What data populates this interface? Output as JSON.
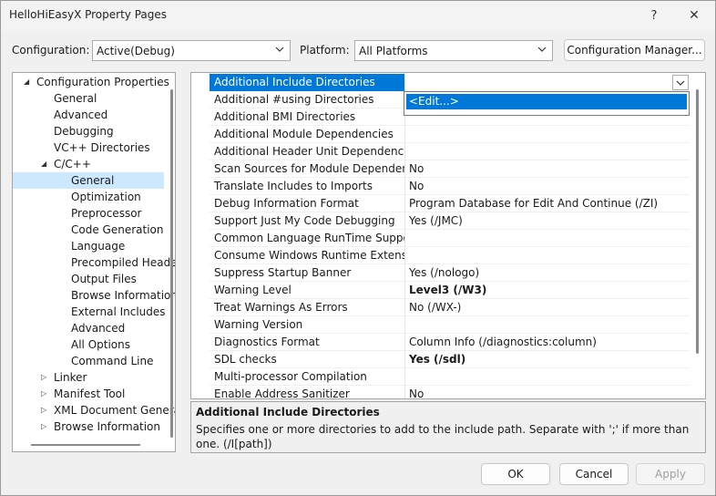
{
  "window": {
    "title": "HelloHiEasyX Property Pages",
    "help_glyph": "?",
    "close_glyph": "✕"
  },
  "top": {
    "configuration_label": "Configuration:",
    "configuration_value": "Active(Debug)",
    "platform_label": "Platform:",
    "platform_value": "All Platforms",
    "config_manager_button": "Configuration Manager..."
  },
  "tree": [
    {
      "label": "Configuration Properties",
      "indent": 0,
      "arrow": "expanded",
      "selected": false
    },
    {
      "label": "General",
      "indent": 1,
      "arrow": "",
      "selected": false
    },
    {
      "label": "Advanced",
      "indent": 1,
      "arrow": "",
      "selected": false
    },
    {
      "label": "Debugging",
      "indent": 1,
      "arrow": "",
      "selected": false
    },
    {
      "label": "VC++ Directories",
      "indent": 1,
      "arrow": "",
      "selected": false
    },
    {
      "label": "C/C++",
      "indent": 1,
      "arrow": "expanded",
      "selected": false
    },
    {
      "label": "General",
      "indent": 2,
      "arrow": "",
      "selected": true
    },
    {
      "label": "Optimization",
      "indent": 2,
      "arrow": "",
      "selected": false
    },
    {
      "label": "Preprocessor",
      "indent": 2,
      "arrow": "",
      "selected": false
    },
    {
      "label": "Code Generation",
      "indent": 2,
      "arrow": "",
      "selected": false
    },
    {
      "label": "Language",
      "indent": 2,
      "arrow": "",
      "selected": false
    },
    {
      "label": "Precompiled Heade",
      "indent": 2,
      "arrow": "",
      "selected": false
    },
    {
      "label": "Output Files",
      "indent": 2,
      "arrow": "",
      "selected": false
    },
    {
      "label": "Browse Information",
      "indent": 2,
      "arrow": "",
      "selected": false
    },
    {
      "label": "External Includes",
      "indent": 2,
      "arrow": "",
      "selected": false
    },
    {
      "label": "Advanced",
      "indent": 2,
      "arrow": "",
      "selected": false
    },
    {
      "label": "All Options",
      "indent": 2,
      "arrow": "",
      "selected": false
    },
    {
      "label": "Command Line",
      "indent": 2,
      "arrow": "",
      "selected": false
    },
    {
      "label": "Linker",
      "indent": 1,
      "arrow": "collapsed",
      "selected": false
    },
    {
      "label": "Manifest Tool",
      "indent": 1,
      "arrow": "collapsed",
      "selected": false
    },
    {
      "label": "XML Document Genera",
      "indent": 1,
      "arrow": "collapsed",
      "selected": false
    },
    {
      "label": "Browse Information",
      "indent": 1,
      "arrow": "collapsed",
      "selected": false
    }
  ],
  "properties": [
    {
      "name": "Additional Include Directories",
      "value": "",
      "bold": false,
      "selected": true
    },
    {
      "name": "Additional #using Directories",
      "value": "",
      "bold": false,
      "selected": false
    },
    {
      "name": "Additional BMI Directories",
      "value": "",
      "bold": false,
      "selected": false
    },
    {
      "name": "Additional Module Dependencies",
      "value": "",
      "bold": false,
      "selected": false
    },
    {
      "name": "Additional Header Unit Dependencies",
      "value": "",
      "bold": false,
      "selected": false
    },
    {
      "name": "Scan Sources for Module Dependencies",
      "value": "No",
      "bold": false,
      "selected": false
    },
    {
      "name": "Translate Includes to Imports",
      "value": "No",
      "bold": false,
      "selected": false
    },
    {
      "name": "Debug Information Format",
      "value": "Program Database for Edit And Continue (/ZI)",
      "bold": false,
      "selected": false
    },
    {
      "name": "Support Just My Code Debugging",
      "value": "Yes (/JMC)",
      "bold": false,
      "selected": false
    },
    {
      "name": "Common Language RunTime Support",
      "value": "",
      "bold": false,
      "selected": false
    },
    {
      "name": "Consume Windows Runtime Extension",
      "value": "",
      "bold": false,
      "selected": false
    },
    {
      "name": "Suppress Startup Banner",
      "value": "Yes (/nologo)",
      "bold": false,
      "selected": false
    },
    {
      "name": "Warning Level",
      "value": "Level3 (/W3)",
      "bold": true,
      "selected": false
    },
    {
      "name": "Treat Warnings As Errors",
      "value": "No (/WX-)",
      "bold": false,
      "selected": false
    },
    {
      "name": "Warning Version",
      "value": "",
      "bold": false,
      "selected": false
    },
    {
      "name": "Diagnostics Format",
      "value": "Column Info (/diagnostics:column)",
      "bold": false,
      "selected": false
    },
    {
      "name": "SDL checks",
      "value": "Yes (/sdl)",
      "bold": true,
      "selected": false
    },
    {
      "name": "Multi-processor Compilation",
      "value": "",
      "bold": false,
      "selected": false
    },
    {
      "name": "Enable Address Sanitizer",
      "value": "No",
      "bold": false,
      "selected": false
    }
  ],
  "dropdown": {
    "item": "<Edit...>"
  },
  "description": {
    "title": "Additional Include Directories",
    "text": "Specifies one or more directories to add to the include path. Separate with ';' if more than one. (/I[path])"
  },
  "buttons": {
    "ok": "OK",
    "cancel": "Cancel",
    "apply": "Apply"
  },
  "colors": {
    "accent": "#0078d7",
    "tree_selection": "#cce8ff"
  }
}
